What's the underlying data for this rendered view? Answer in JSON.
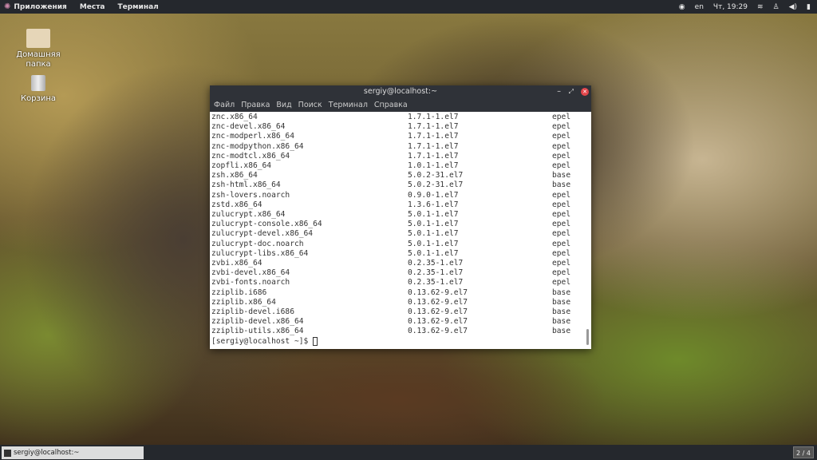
{
  "topbar": {
    "applications": "Приложения",
    "places": "Места",
    "terminal": "Терминал",
    "lang": "en",
    "clock": "Чт, 19:29"
  },
  "desktop": {
    "home": "Домашняя папка",
    "trash": "Корзина"
  },
  "window": {
    "title": "sergiy@localhost:~",
    "menu": [
      "Файл",
      "Правка",
      "Вид",
      "Поиск",
      "Терминал",
      "Справка"
    ]
  },
  "rows": [
    [
      "znc.x86_64",
      "1.7.1-1.el7",
      "epel"
    ],
    [
      "znc-devel.x86_64",
      "1.7.1-1.el7",
      "epel"
    ],
    [
      "znc-modperl.x86_64",
      "1.7.1-1.el7",
      "epel"
    ],
    [
      "znc-modpython.x86_64",
      "1.7.1-1.el7",
      "epel"
    ],
    [
      "znc-modtcl.x86_64",
      "1.7.1-1.el7",
      "epel"
    ],
    [
      "zopfli.x86_64",
      "1.0.1-1.el7",
      "epel"
    ],
    [
      "zsh.x86_64",
      "5.0.2-31.el7",
      "base"
    ],
    [
      "zsh-html.x86_64",
      "5.0.2-31.el7",
      "base"
    ],
    [
      "zsh-lovers.noarch",
      "0.9.0-1.el7",
      "epel"
    ],
    [
      "zstd.x86_64",
      "1.3.6-1.el7",
      "epel"
    ],
    [
      "zulucrypt.x86_64",
      "5.0.1-1.el7",
      "epel"
    ],
    [
      "zulucrypt-console.x86_64",
      "5.0.1-1.el7",
      "epel"
    ],
    [
      "zulucrypt-devel.x86_64",
      "5.0.1-1.el7",
      "epel"
    ],
    [
      "zulucrypt-doc.noarch",
      "5.0.1-1.el7",
      "epel"
    ],
    [
      "zulucrypt-libs.x86_64",
      "5.0.1-1.el7",
      "epel"
    ],
    [
      "zvbi.x86_64",
      "0.2.35-1.el7",
      "epel"
    ],
    [
      "zvbi-devel.x86_64",
      "0.2.35-1.el7",
      "epel"
    ],
    [
      "zvbi-fonts.noarch",
      "0.2.35-1.el7",
      "epel"
    ],
    [
      "zziplib.i686",
      "0.13.62-9.el7",
      "base"
    ],
    [
      "zziplib.x86_64",
      "0.13.62-9.el7",
      "base"
    ],
    [
      "zziplib-devel.i686",
      "0.13.62-9.el7",
      "base"
    ],
    [
      "zziplib-devel.x86_64",
      "0.13.62-9.el7",
      "base"
    ],
    [
      "zziplib-utils.x86_64",
      "0.13.62-9.el7",
      "base"
    ]
  ],
  "prompt": "[sergiy@localhost ~]$ ",
  "taskbar": {
    "task": "sergiy@localhost:~",
    "workspace": "2 / 4"
  }
}
